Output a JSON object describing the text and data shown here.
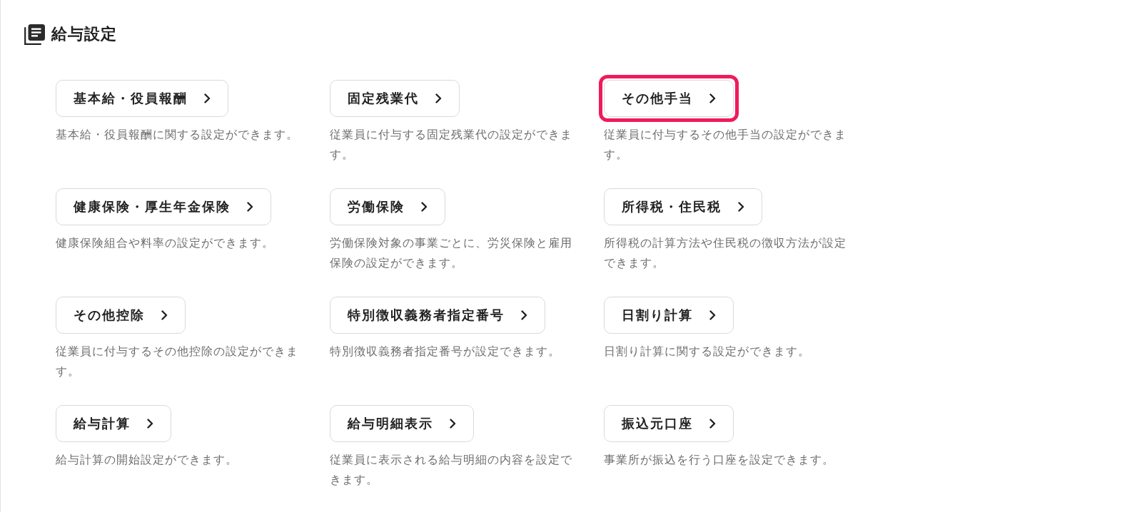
{
  "title": "給与設定",
  "items": [
    {
      "label": "基本給・役員報酬",
      "description": "基本給・役員報酬に関する設定ができます。",
      "highlighted": false
    },
    {
      "label": "固定残業代",
      "description": "従業員に付与する固定残業代の設定ができます。",
      "highlighted": false
    },
    {
      "label": "その他手当",
      "description": "従業員に付与するその他手当の設定ができます。",
      "highlighted": true
    },
    {
      "label": "健康保険・厚生年金保険",
      "description": "健康保険組合や料率の設定ができます。",
      "highlighted": false
    },
    {
      "label": "労働保険",
      "description": "労働保険対象の事業ごとに、労災保険と雇用保険の設定ができます。",
      "highlighted": false
    },
    {
      "label": "所得税・住民税",
      "description": "所得税の計算方法や住民税の徴収方法が設定できます。",
      "highlighted": false
    },
    {
      "label": "その他控除",
      "description": "従業員に付与するその他控除の設定ができます。",
      "highlighted": false
    },
    {
      "label": "特別徴収義務者指定番号",
      "description": "特別徴収義務者指定番号が設定できます。",
      "highlighted": false
    },
    {
      "label": "日割り計算",
      "description": "日割り計算に関する設定ができます。",
      "highlighted": false
    },
    {
      "label": "給与計算",
      "description": "給与計算の開始設定ができます。",
      "highlighted": false
    },
    {
      "label": "給与明細表示",
      "description": "従業員に表示される給与明細の内容を設定できます。",
      "highlighted": false
    },
    {
      "label": "振込元口座",
      "description": "事業所が振込を行う口座を設定できます。",
      "highlighted": false
    }
  ]
}
